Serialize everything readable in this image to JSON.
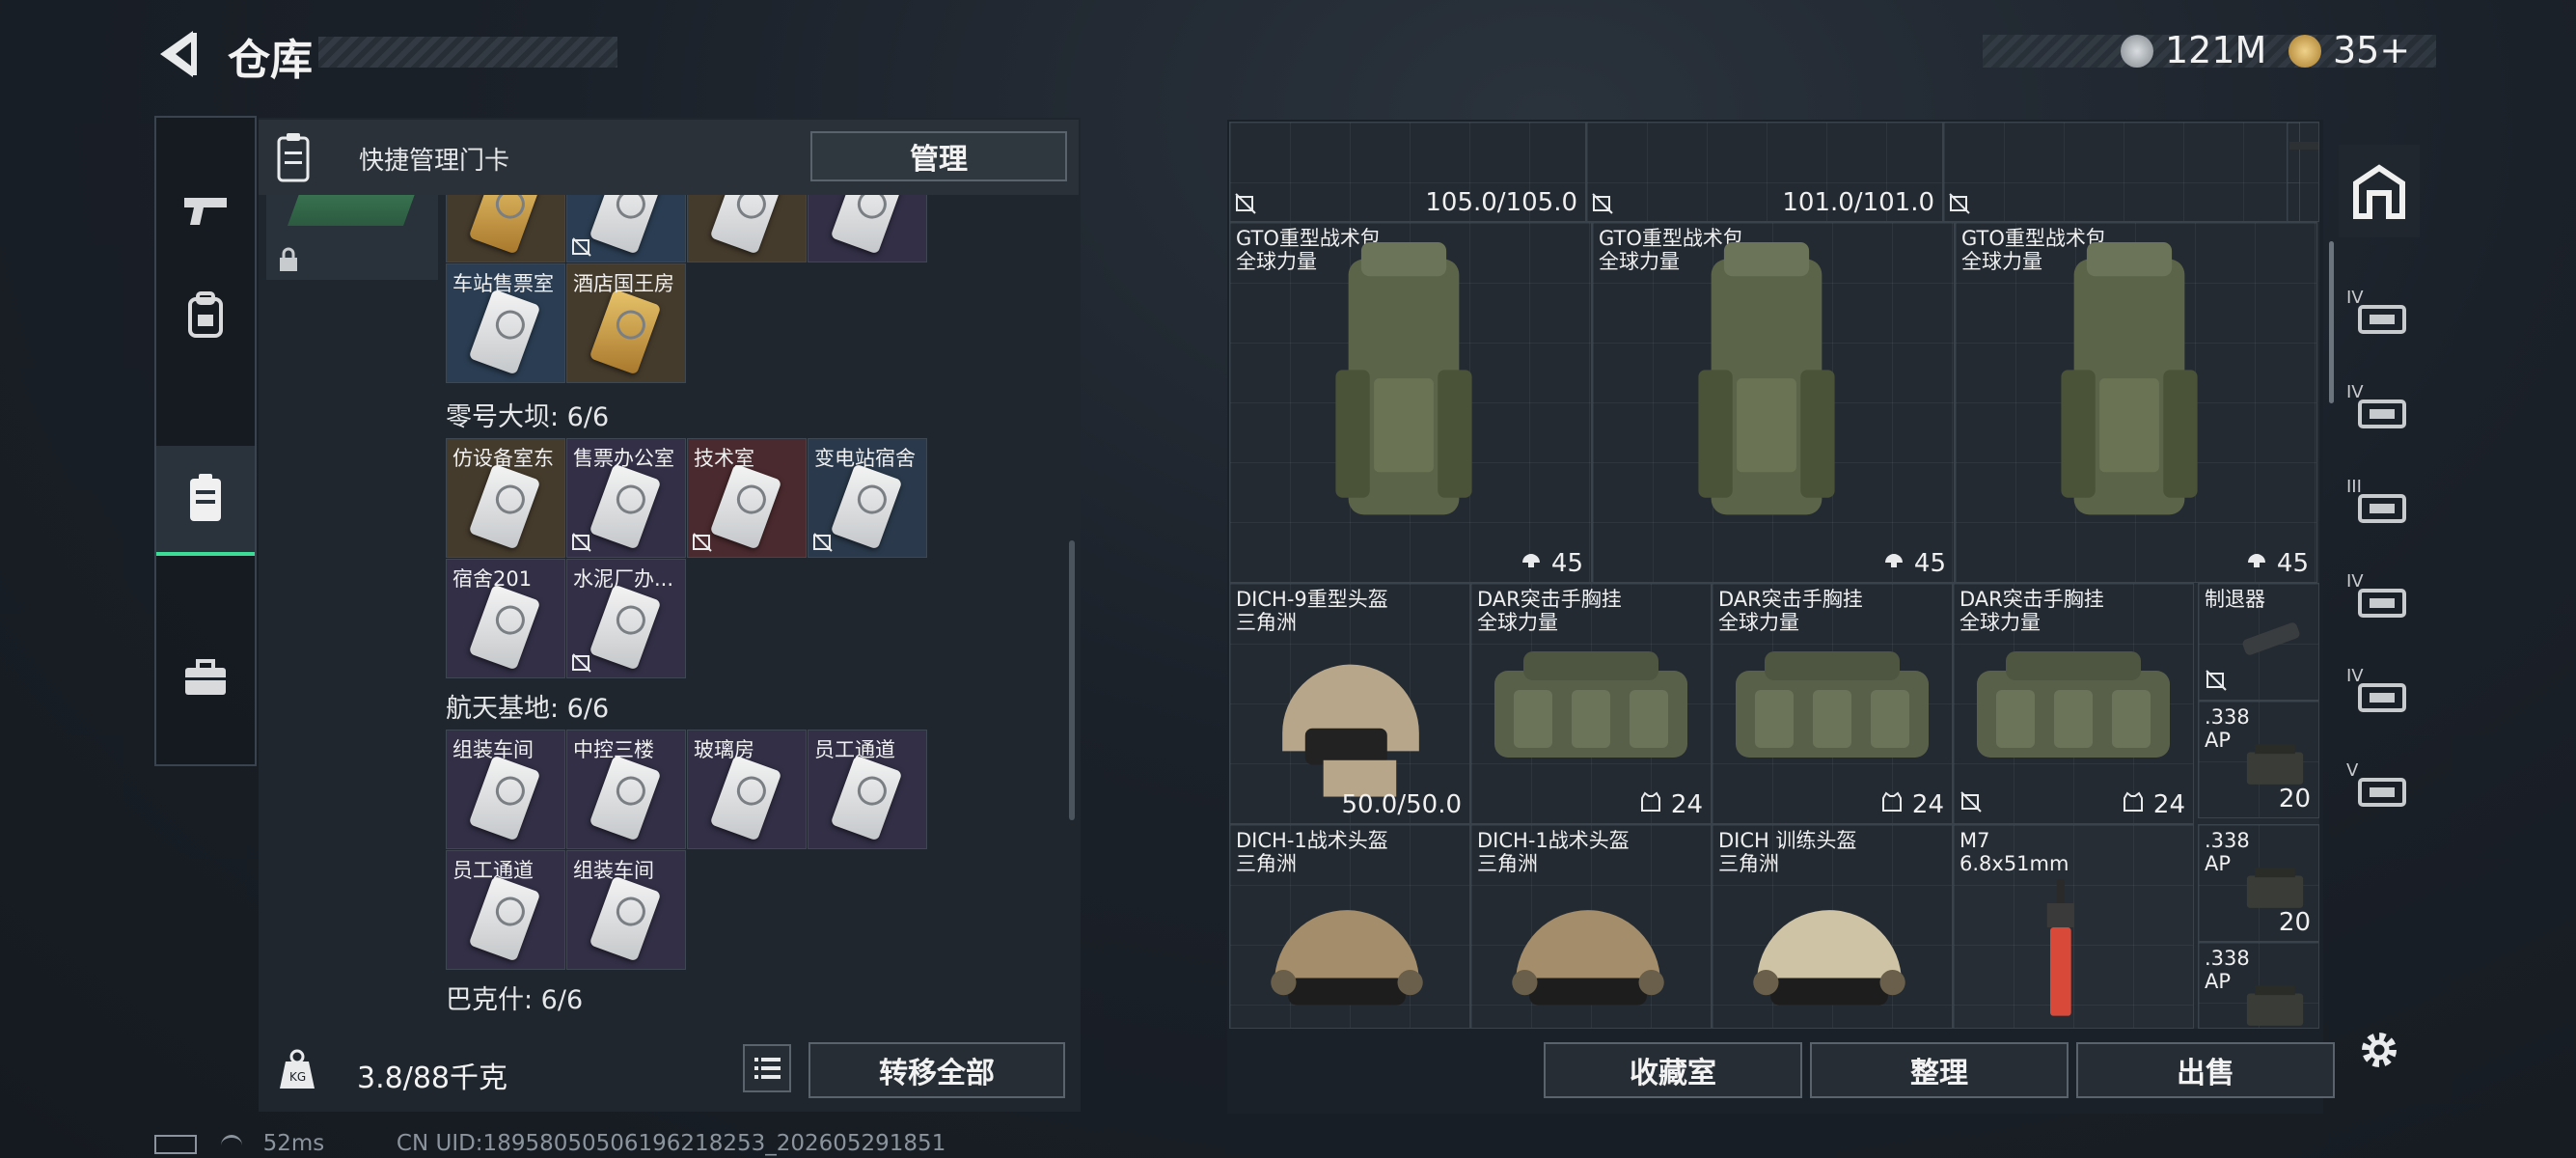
{
  "header": {
    "title": "仓库",
    "currency1": "121M",
    "currency2": "35+"
  },
  "quick": {
    "label": "快捷管理门卡",
    "manage": "管理"
  },
  "cards_top": [
    {
      "name": "",
      "bg": "c-gold",
      "gold": true,
      "nt": false
    },
    {
      "name": "",
      "bg": "c-blue",
      "gold": false,
      "nt": true
    },
    {
      "name": "",
      "bg": "c-gold",
      "gold": false,
      "nt": false
    },
    {
      "name": "",
      "bg": "c-purple",
      "gold": false,
      "nt": false
    },
    {
      "name": "车站售票室",
      "bg": "c-blue",
      "gold": false,
      "nt": false
    },
    {
      "name": "酒店国王房",
      "bg": "c-gold",
      "gold": true,
      "nt": false
    }
  ],
  "sections": [
    {
      "title": "零号大坝: 6/6",
      "cards": [
        {
          "name": "仿设备室东",
          "bg": "c-gold",
          "gold": false,
          "nt": false
        },
        {
          "name": "售票办公室",
          "bg": "c-purple",
          "gold": false,
          "nt": true
        },
        {
          "name": "技术室",
          "bg": "c-red",
          "gold": false,
          "nt": true
        },
        {
          "name": "变电站宿舍",
          "bg": "c-steel",
          "gold": false,
          "nt": true
        },
        {
          "name": "宿舍201",
          "bg": "c-purple",
          "gold": false,
          "nt": false
        },
        {
          "name": "水泥厂办...",
          "bg": "c-purple",
          "gold": false,
          "nt": true
        }
      ]
    },
    {
      "title": "航天基地: 6/6",
      "cards": [
        {
          "name": "组装车间",
          "bg": "c-purple",
          "gold": false,
          "nt": false
        },
        {
          "name": "中控三楼",
          "bg": "c-purple",
          "gold": false,
          "nt": false
        },
        {
          "name": "玻璃房",
          "bg": "c-purple",
          "gold": false,
          "nt": false
        },
        {
          "name": "员工通道",
          "bg": "c-purple",
          "gold": false,
          "nt": false
        },
        {
          "name": "员工通道",
          "bg": "c-purple",
          "gold": false,
          "nt": false
        },
        {
          "name": "组装车间",
          "bg": "c-purple",
          "gold": false,
          "nt": false
        }
      ]
    },
    {
      "title": "巴克什: 6/6",
      "cards": []
    }
  ],
  "weight": {
    "text": "3.8/88千克"
  },
  "transfer": "转移全部",
  "inventory": {
    "row0": [
      {
        "value": "105.0/105.0"
      },
      {
        "value": "101.0/101.0"
      }
    ],
    "backpacks": [
      {
        "name": "GTO重型战术包\n全球力量",
        "value": "45"
      },
      {
        "name": "GTO重型战术包\n全球力量",
        "value": "45"
      },
      {
        "name": "GTO重型战术包\n全球力量",
        "value": "45"
      }
    ],
    "row2": [
      {
        "name": "DICH-9重型头盔\n三角洲",
        "value": "50.0/50.0",
        "bg": "bg-red",
        "kind": "helmet-heavy"
      },
      {
        "name": "DAR突击手胸挂\n全球力量",
        "value": "24",
        "bg": "bg-gold",
        "kind": "vest"
      },
      {
        "name": "DAR突击手胸挂\n全球力量",
        "value": "24",
        "bg": "bg-gold",
        "kind": "vest"
      },
      {
        "name": "DAR突击手胸挂\n全球力量",
        "value": "24",
        "bg": "bg-gold",
        "kind": "vest"
      }
    ],
    "row3": [
      {
        "name": "DICH-1战术头盔\n三角洲",
        "bg": "bg-purple",
        "kind": "helmet"
      },
      {
        "name": "DICH-1战术头盔\n三角洲",
        "bg": "bg-purple",
        "kind": "helmet"
      },
      {
        "name": "DICH 训练头盔\n三角洲",
        "bg": "bg-blue",
        "kind": "helmet-light"
      },
      {
        "name": "M7\n6.8x51mm",
        "bg": "bg-dark",
        "kind": "rifle"
      }
    ],
    "side": [
      {
        "name": "制退器",
        "value": "",
        "bg": "bg-blue"
      },
      {
        "name": ".338\nAP",
        "value": "20",
        "bg": "bg-red"
      },
      {
        "name": ".338\nAP",
        "value": "20",
        "bg": "bg-red"
      },
      {
        "name": ".338\nAP",
        "value": "",
        "bg": "bg-red"
      }
    ]
  },
  "buttons": {
    "collection": "收藏室",
    "organize": "整理",
    "sell": "出售"
  },
  "rnav": [
    "IV",
    "IV",
    "III",
    "IV",
    "IV",
    "V"
  ],
  "footer": {
    "ping": "52ms",
    "uid": "CN UID:18958050506196218253_202605291851"
  },
  "colors": {
    "accent": "#3ddc97",
    "panel": "#1f262e",
    "text": "#e6e8ea"
  }
}
